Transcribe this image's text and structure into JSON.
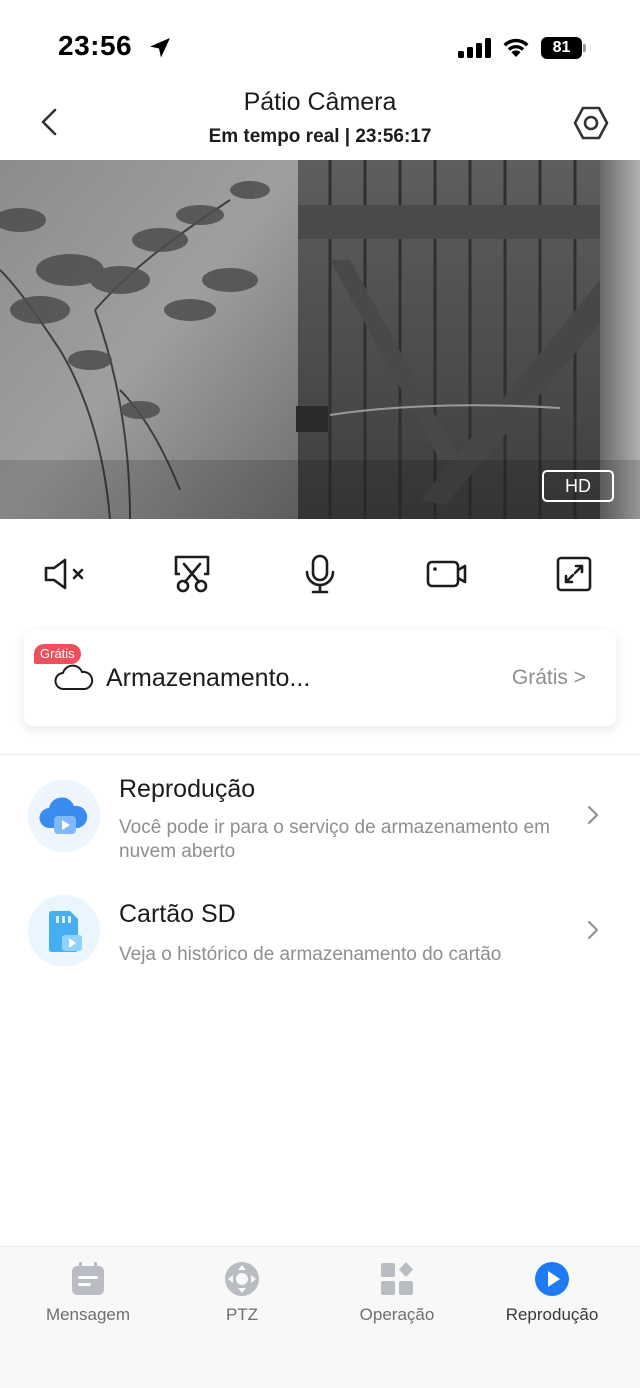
{
  "status_bar": {
    "time": "23:56",
    "battery": "81"
  },
  "header": {
    "title": "Pátio Câmera",
    "subtitle": "Em tempo real | 23:56:17"
  },
  "video": {
    "quality_badge": "HD"
  },
  "controls": [
    {
      "icon": "speaker-muted-icon"
    },
    {
      "icon": "screenshot-scissors-icon"
    },
    {
      "icon": "microphone-icon"
    },
    {
      "icon": "video-record-icon"
    },
    {
      "icon": "fullscreen-icon"
    }
  ],
  "cloud_card": {
    "tag": "Grátis",
    "label": "Armazenamento...",
    "status": "Grátis >"
  },
  "list": [
    {
      "title": "Reprodução",
      "description": "Você pode ir para o serviço de armazenamento em nuvem aberto"
    },
    {
      "title": "Cartão SD",
      "description": "Veja o histórico de armazenamento do cartão"
    }
  ],
  "tabs": [
    {
      "label": "Mensagem",
      "icon": "message-icon"
    },
    {
      "label": "PTZ",
      "icon": "ptz-icon"
    },
    {
      "label": "Operação",
      "icon": "operation-icon"
    },
    {
      "label": "Reprodução",
      "icon": "playback-icon",
      "active": true
    }
  ],
  "colors": {
    "accent": "#1e7bf0",
    "free_tag": "#ef4f5b",
    "secondary_text": "#8e8e93"
  }
}
